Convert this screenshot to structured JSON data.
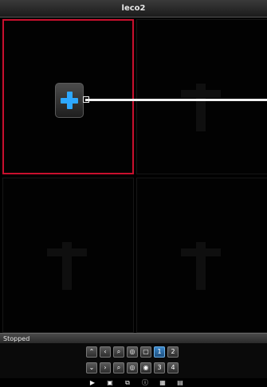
{
  "window": {
    "title": "leco2"
  },
  "status": {
    "text": "Stopped"
  },
  "panes": [
    {
      "id": "pane-1",
      "state": "empty-selected",
      "action_icon": "plus-icon"
    },
    {
      "id": "pane-2",
      "state": "empty",
      "action_icon": "ghost-plus-icon"
    },
    {
      "id": "pane-3",
      "state": "empty",
      "action_icon": "ghost-plus-icon"
    },
    {
      "id": "pane-4",
      "state": "empty",
      "action_icon": "ghost-plus-icon"
    }
  ],
  "controls": {
    "row1": [
      {
        "name": "up-arrow-button",
        "glyph": "⌃"
      },
      {
        "name": "left-arrow-button",
        "glyph": "‹"
      },
      {
        "name": "zoom-in-button",
        "glyph": "⌕"
      },
      {
        "name": "focus-button",
        "glyph": "◎"
      },
      {
        "name": "iris-button",
        "glyph": "▢"
      },
      {
        "name": "layout-1-button",
        "glyph": "1"
      },
      {
        "name": "layout-2-button",
        "glyph": "2"
      }
    ],
    "row2": [
      {
        "name": "down-arrow-button",
        "glyph": "⌄"
      },
      {
        "name": "right-arrow-button",
        "glyph": "›"
      },
      {
        "name": "zoom-out-button",
        "glyph": "⌕"
      },
      {
        "name": "focus-out-button",
        "glyph": "◎"
      },
      {
        "name": "iris-close-button",
        "glyph": "◉"
      },
      {
        "name": "layout-3-button",
        "glyph": "3"
      },
      {
        "name": "layout-4-button",
        "glyph": "4"
      }
    ],
    "active": "layout-1-button"
  },
  "toolbar": [
    {
      "name": "play-button",
      "glyph": "▶"
    },
    {
      "name": "snapshot-button",
      "glyph": "▣"
    },
    {
      "name": "record-button",
      "glyph": "⧉"
    },
    {
      "name": "info-button",
      "glyph": "ⓘ"
    },
    {
      "name": "grid-view-button",
      "glyph": "▦"
    },
    {
      "name": "layout-button",
      "glyph": "▤"
    }
  ],
  "colors": {
    "selected_border": "#c8102e",
    "plus": "#2ea8ff",
    "active_button": "#3a86c8"
  }
}
